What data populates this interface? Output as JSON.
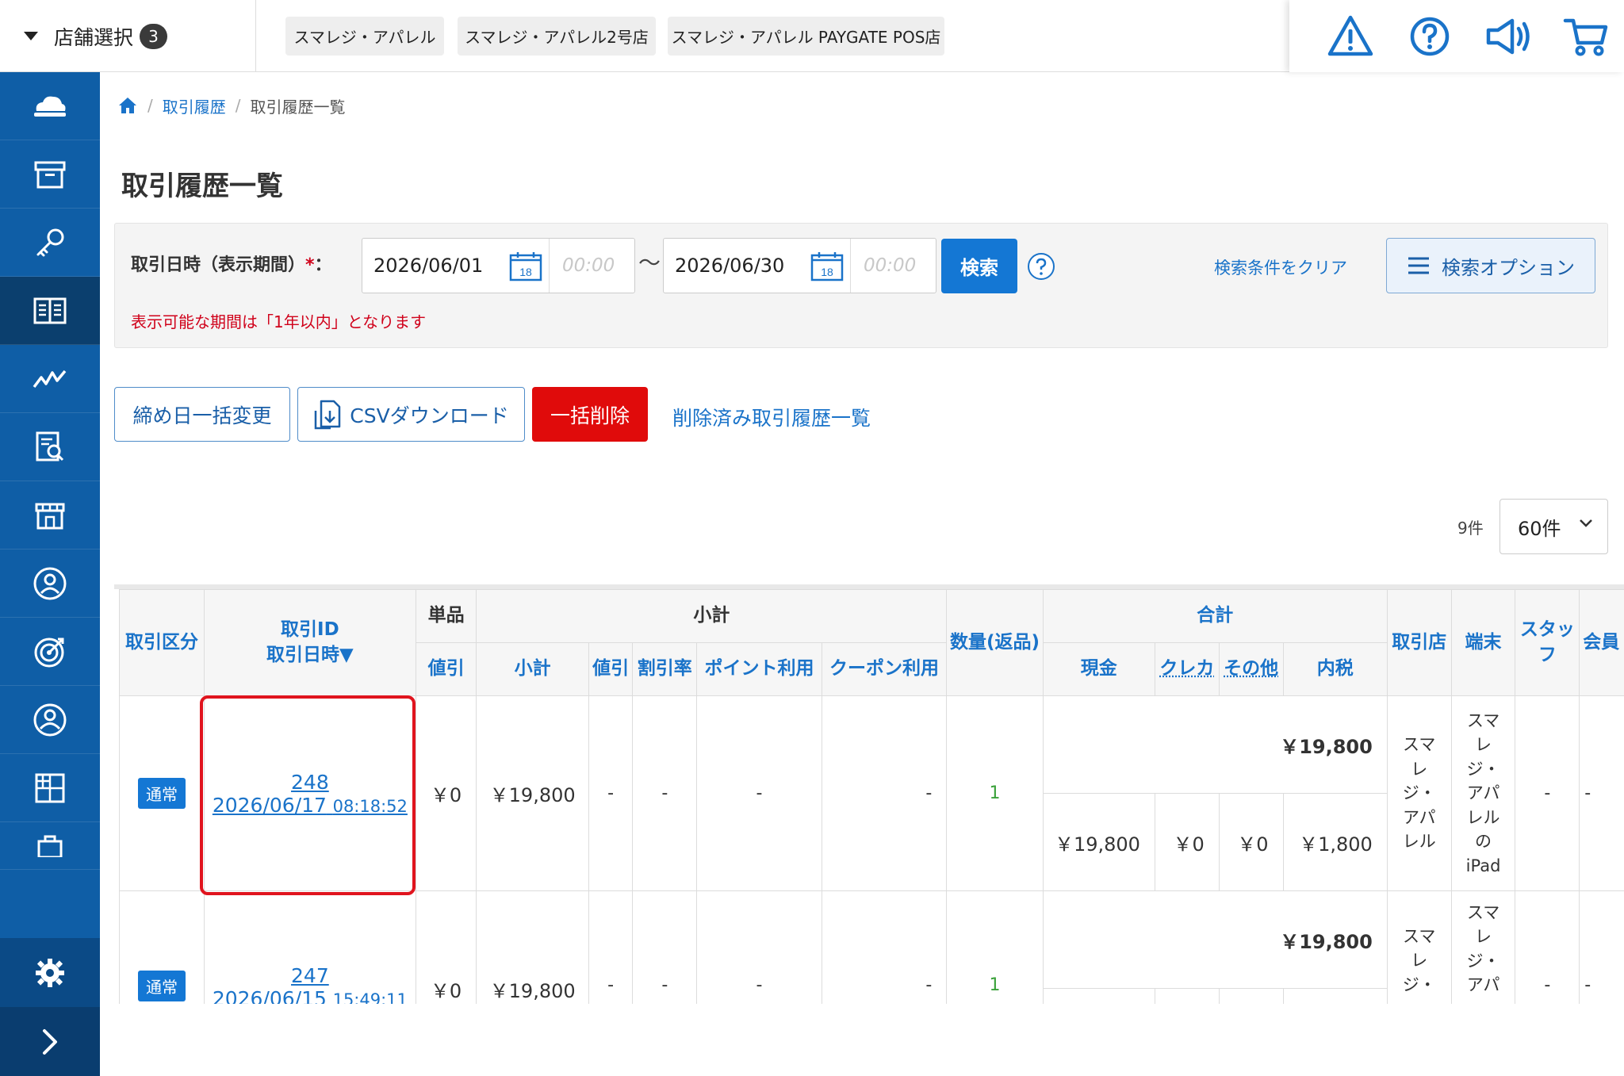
{
  "header": {
    "store_select_label": "店舗選択",
    "store_select_count": "3",
    "stores": [
      "スマレジ・アパレル",
      "スマレジ・アパレル2号店",
      "スマレジ・アパレル PAYGATE POS店"
    ],
    "icons": [
      "warning-icon",
      "help-icon",
      "announcement-icon",
      "cart-icon"
    ]
  },
  "sidebar": {
    "items": [
      "cloud-icon",
      "archive-icon",
      "key-icon",
      "book-icon",
      "chart-icon",
      "report-icon",
      "store-icon",
      "user-badge-icon",
      "target-icon",
      "customer-icon",
      "grid-icon",
      "bag-icon"
    ],
    "active_index": 3,
    "bottom": [
      "gear-icon",
      "chevron-right-icon"
    ]
  },
  "breadcrumb": {
    "parent": "取引履歴",
    "current": "取引履歴一覧"
  },
  "page_title": "取引履歴一覧",
  "search": {
    "date_label": "取引日時（表示期間）",
    "required_mark": "*",
    "colon": "：",
    "start_date": "2026/06/01",
    "start_time_placeholder": "00:00",
    "end_date": "2026/06/30",
    "end_time_placeholder": "00:00",
    "calendar_day": "18",
    "tilde": "〜",
    "search_button": "検索",
    "clear_link": "検索条件をクリア",
    "options_button": "検索オプション",
    "period_note": "表示可能な期間は「1年以内」となります"
  },
  "actions": {
    "close_date_change": "締め日一括変更",
    "csv_download": "CSVダウンロード",
    "bulk_delete": "一括削除",
    "deleted_history_link": "削除済み取引履歴一覧"
  },
  "pagination": {
    "count": "9件",
    "per_page": "60件"
  },
  "table": {
    "headers": {
      "type": "取引区分",
      "id_line1": "取引ID",
      "id_line2": "取引日時▼",
      "unit": "単品",
      "unit_discount": "値引",
      "subtotal_group": "小計",
      "subtotal": "小計",
      "sub_discount": "値引",
      "discount_rate": "割引率",
      "point_use": "ポイント利用",
      "coupon_use": "クーポン利用",
      "quantity": "数量(返品)",
      "total_group": "合計",
      "cash": "現金",
      "credit": "クレカ",
      "other": "その他",
      "tax_included": "内税",
      "store": "取引店",
      "terminal": "端末",
      "staff": "スタッフ",
      "member": "会員"
    },
    "rows": [
      {
        "type": "通常",
        "id": "248",
        "date": "2026/06/17",
        "time": "08:18:52",
        "unit_discount": "￥0",
        "subtotal": "￥19,800",
        "sub_discount": "-",
        "discount_rate": "-",
        "point_use": "-",
        "coupon_use": "-",
        "quantity": "1",
        "total": "￥19,800",
        "cash": "￥19,800",
        "credit": "￥0",
        "other": "￥0",
        "tax_included": "￥1,800",
        "store_lines": [
          "スマ",
          "レ",
          "ジ・",
          "アパ",
          "レル"
        ],
        "terminal_lines": [
          "スマ",
          "レ",
          "ジ・",
          "アパ",
          "レル",
          "の",
          "iPad"
        ],
        "staff": "-",
        "member": "-"
      },
      {
        "type": "通常",
        "id": "247",
        "date": "2026/06/15",
        "time": "15:49:11",
        "unit_discount": "￥0",
        "subtotal": "￥19,800",
        "sub_discount": "-",
        "discount_rate": "-",
        "point_use": "-",
        "coupon_use": "-",
        "quantity": "1",
        "total": "￥19,800",
        "store_lines": [
          "スマ",
          "レ",
          "ジ・"
        ],
        "terminal_lines": [
          "スマ",
          "レ",
          "ジ・",
          "アパ"
        ],
        "staff": "-",
        "member": "-"
      }
    ]
  },
  "colors": {
    "primary": "#1477d4",
    "sidebar": "#0f5ea6",
    "danger": "#e00b0b",
    "link": "#1a73c9"
  }
}
